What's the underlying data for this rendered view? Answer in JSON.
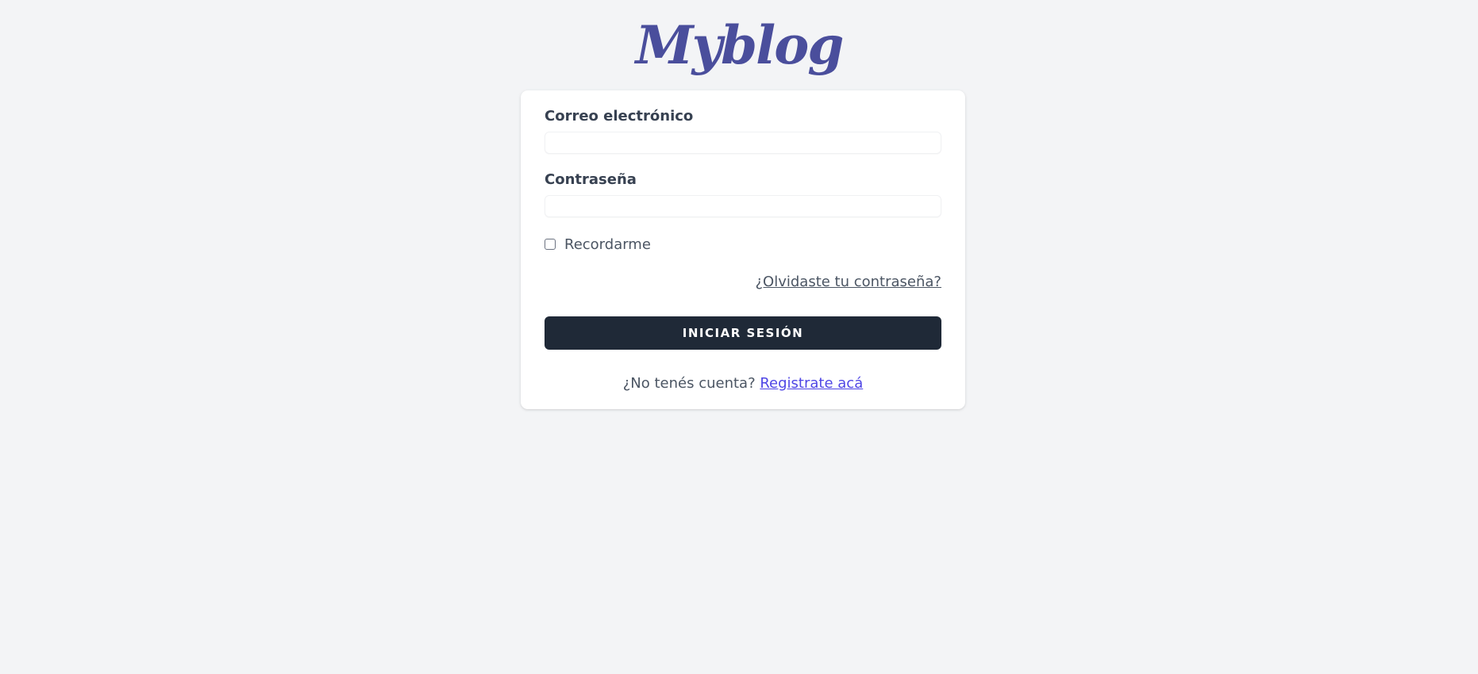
{
  "logo": {
    "text": "Myblog",
    "color": "#4a4e9c"
  },
  "form": {
    "email_label": "Correo electrónico",
    "email_value": "",
    "password_label": "Contraseña",
    "password_value": "",
    "remember_label": "Recordarme",
    "remember_checked": false,
    "forgot_link": "¿Olvidaste tu contraseña?",
    "submit_label": "INICIAR SESIÓN",
    "signup_prompt": "¿No tenés cuenta?",
    "signup_link": "Registrate acá"
  },
  "colors": {
    "background": "#f3f4f6",
    "button": "#1f2937",
    "link_accent": "#4f46e5"
  }
}
